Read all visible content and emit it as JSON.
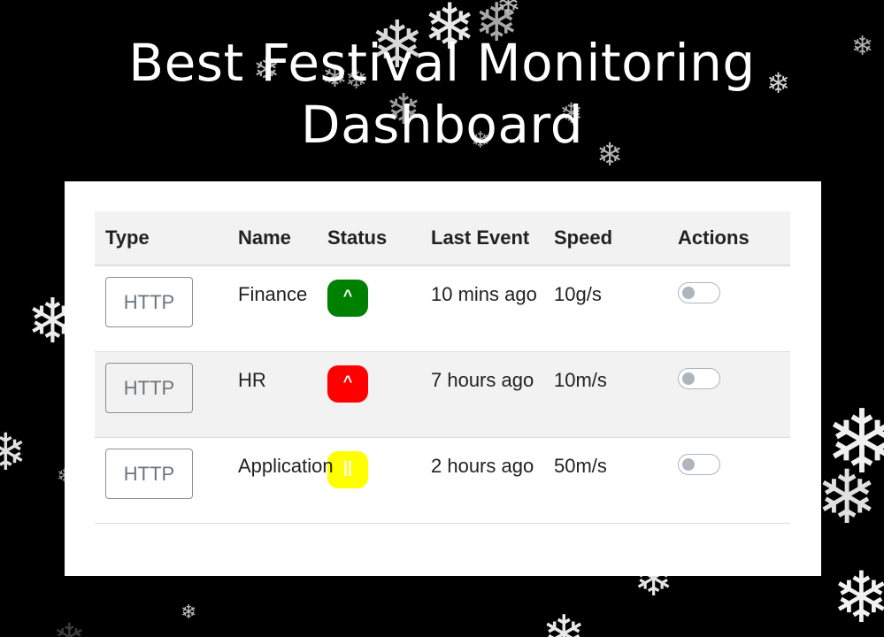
{
  "page": {
    "title_line1": "Best Festival Monitoring",
    "title_line2": "Dashboard"
  },
  "table": {
    "headers": {
      "type": "Type",
      "name": "Name",
      "status": "Status",
      "last_event": "Last Event",
      "speed": "Speed",
      "actions": "Actions"
    },
    "rows": [
      {
        "type": "HTTP",
        "name": "Finance",
        "status_symbol": "^",
        "status_color": "#008000",
        "last_event": "10 mins ago",
        "speed": "10g/s",
        "toggle_on": false
      },
      {
        "type": "HTTP",
        "name": "HR",
        "status_symbol": "^",
        "status_color": "#ff0000",
        "last_event": "7 hours ago",
        "speed": "10m/s",
        "toggle_on": false
      },
      {
        "type": "HTTP",
        "name": "Application",
        "status_symbol": "||",
        "status_color": "#ffff00",
        "last_event": "2 hours ago",
        "speed": "50m/s",
        "toggle_on": false
      }
    ]
  },
  "theme": {
    "background": "#000000",
    "panel": "#ffffff",
    "header_row": "#f2f2f2",
    "snowflake": "snowflake-icon"
  }
}
